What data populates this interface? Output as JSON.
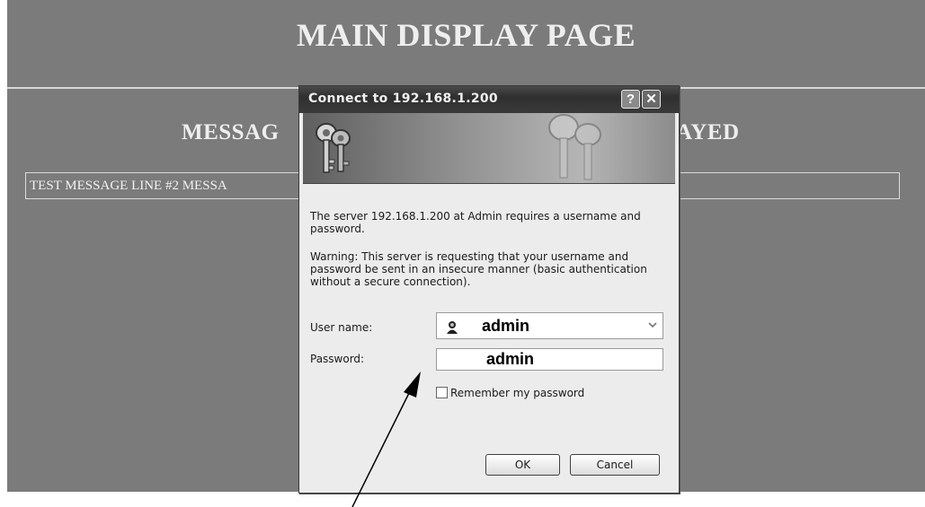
{
  "page": {
    "title": "MAIN DISPLAY PAGE",
    "message_heading_left": "MESSAG",
    "message_heading_right": "AYED",
    "message_line": "TEST MESSAGE LINE #2 MESSA"
  },
  "dialog": {
    "title": "Connect to 192.168.1.200",
    "help_button": "?",
    "close_button": "✕",
    "text1": "The server 192.168.1.200 at Admin requires a username and password.",
    "text2": "Warning: This server is requesting that your username and password be sent in an insecure manner (basic authentication without a secure connection).",
    "username_label": "User name:",
    "username_value": "admin",
    "password_label": "Password:",
    "password_value": "admin",
    "remember_label": "Remember my password",
    "remember_checked": false,
    "ok_label": "OK",
    "cancel_label": "Cancel"
  },
  "icons": [
    "keys-icon",
    "keys-watermark-icon",
    "user-icon",
    "chevron-down-icon",
    "help-icon",
    "close-icon"
  ]
}
